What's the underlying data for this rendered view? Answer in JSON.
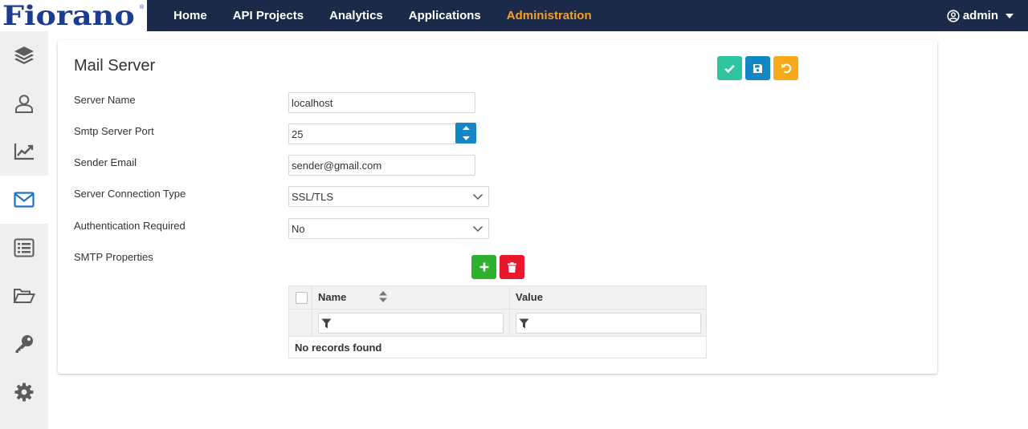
{
  "brand": {
    "logo": "Fiorano",
    "reg": "®"
  },
  "nav": {
    "items": [
      {
        "label": "Home"
      },
      {
        "label": "API Projects"
      },
      {
        "label": "Analytics"
      },
      {
        "label": "Applications"
      },
      {
        "label": "Administration",
        "active": true
      }
    ],
    "user": "admin"
  },
  "sidebar": {
    "items": [
      {
        "icon": "layers-icon"
      },
      {
        "icon": "user-icon"
      },
      {
        "icon": "chart-icon"
      },
      {
        "icon": "mail-icon",
        "active": true
      },
      {
        "icon": "list-icon"
      },
      {
        "icon": "folder-open-icon"
      },
      {
        "icon": "key-icon"
      },
      {
        "icon": "gear-icon"
      }
    ]
  },
  "form": {
    "title": "Mail Server",
    "fields": {
      "server_name": {
        "label": "Server Name",
        "value": "localhost"
      },
      "smtp_port": {
        "label": "Smtp Server Port",
        "value": "25"
      },
      "sender_email": {
        "label": "Sender Email",
        "value": "sender@gmail.com"
      },
      "connection_type": {
        "label": "Server Connection Type",
        "value": "SSL/TLS"
      },
      "auth_required": {
        "label": "Authentication Required",
        "value": "No"
      },
      "smtp_properties": {
        "label": "SMTP Properties"
      }
    }
  },
  "table": {
    "columns": [
      {
        "label": "Name"
      },
      {
        "label": "Value"
      }
    ],
    "empty_message": "No records found"
  },
  "colors": {
    "topbar": "#1c2a4a",
    "active_nav": "#f5a023",
    "confirm": "#2ec4a0",
    "save": "#1586c4",
    "reset": "#f7a81b",
    "add": "#2db02d",
    "delete": "#e8192c"
  }
}
